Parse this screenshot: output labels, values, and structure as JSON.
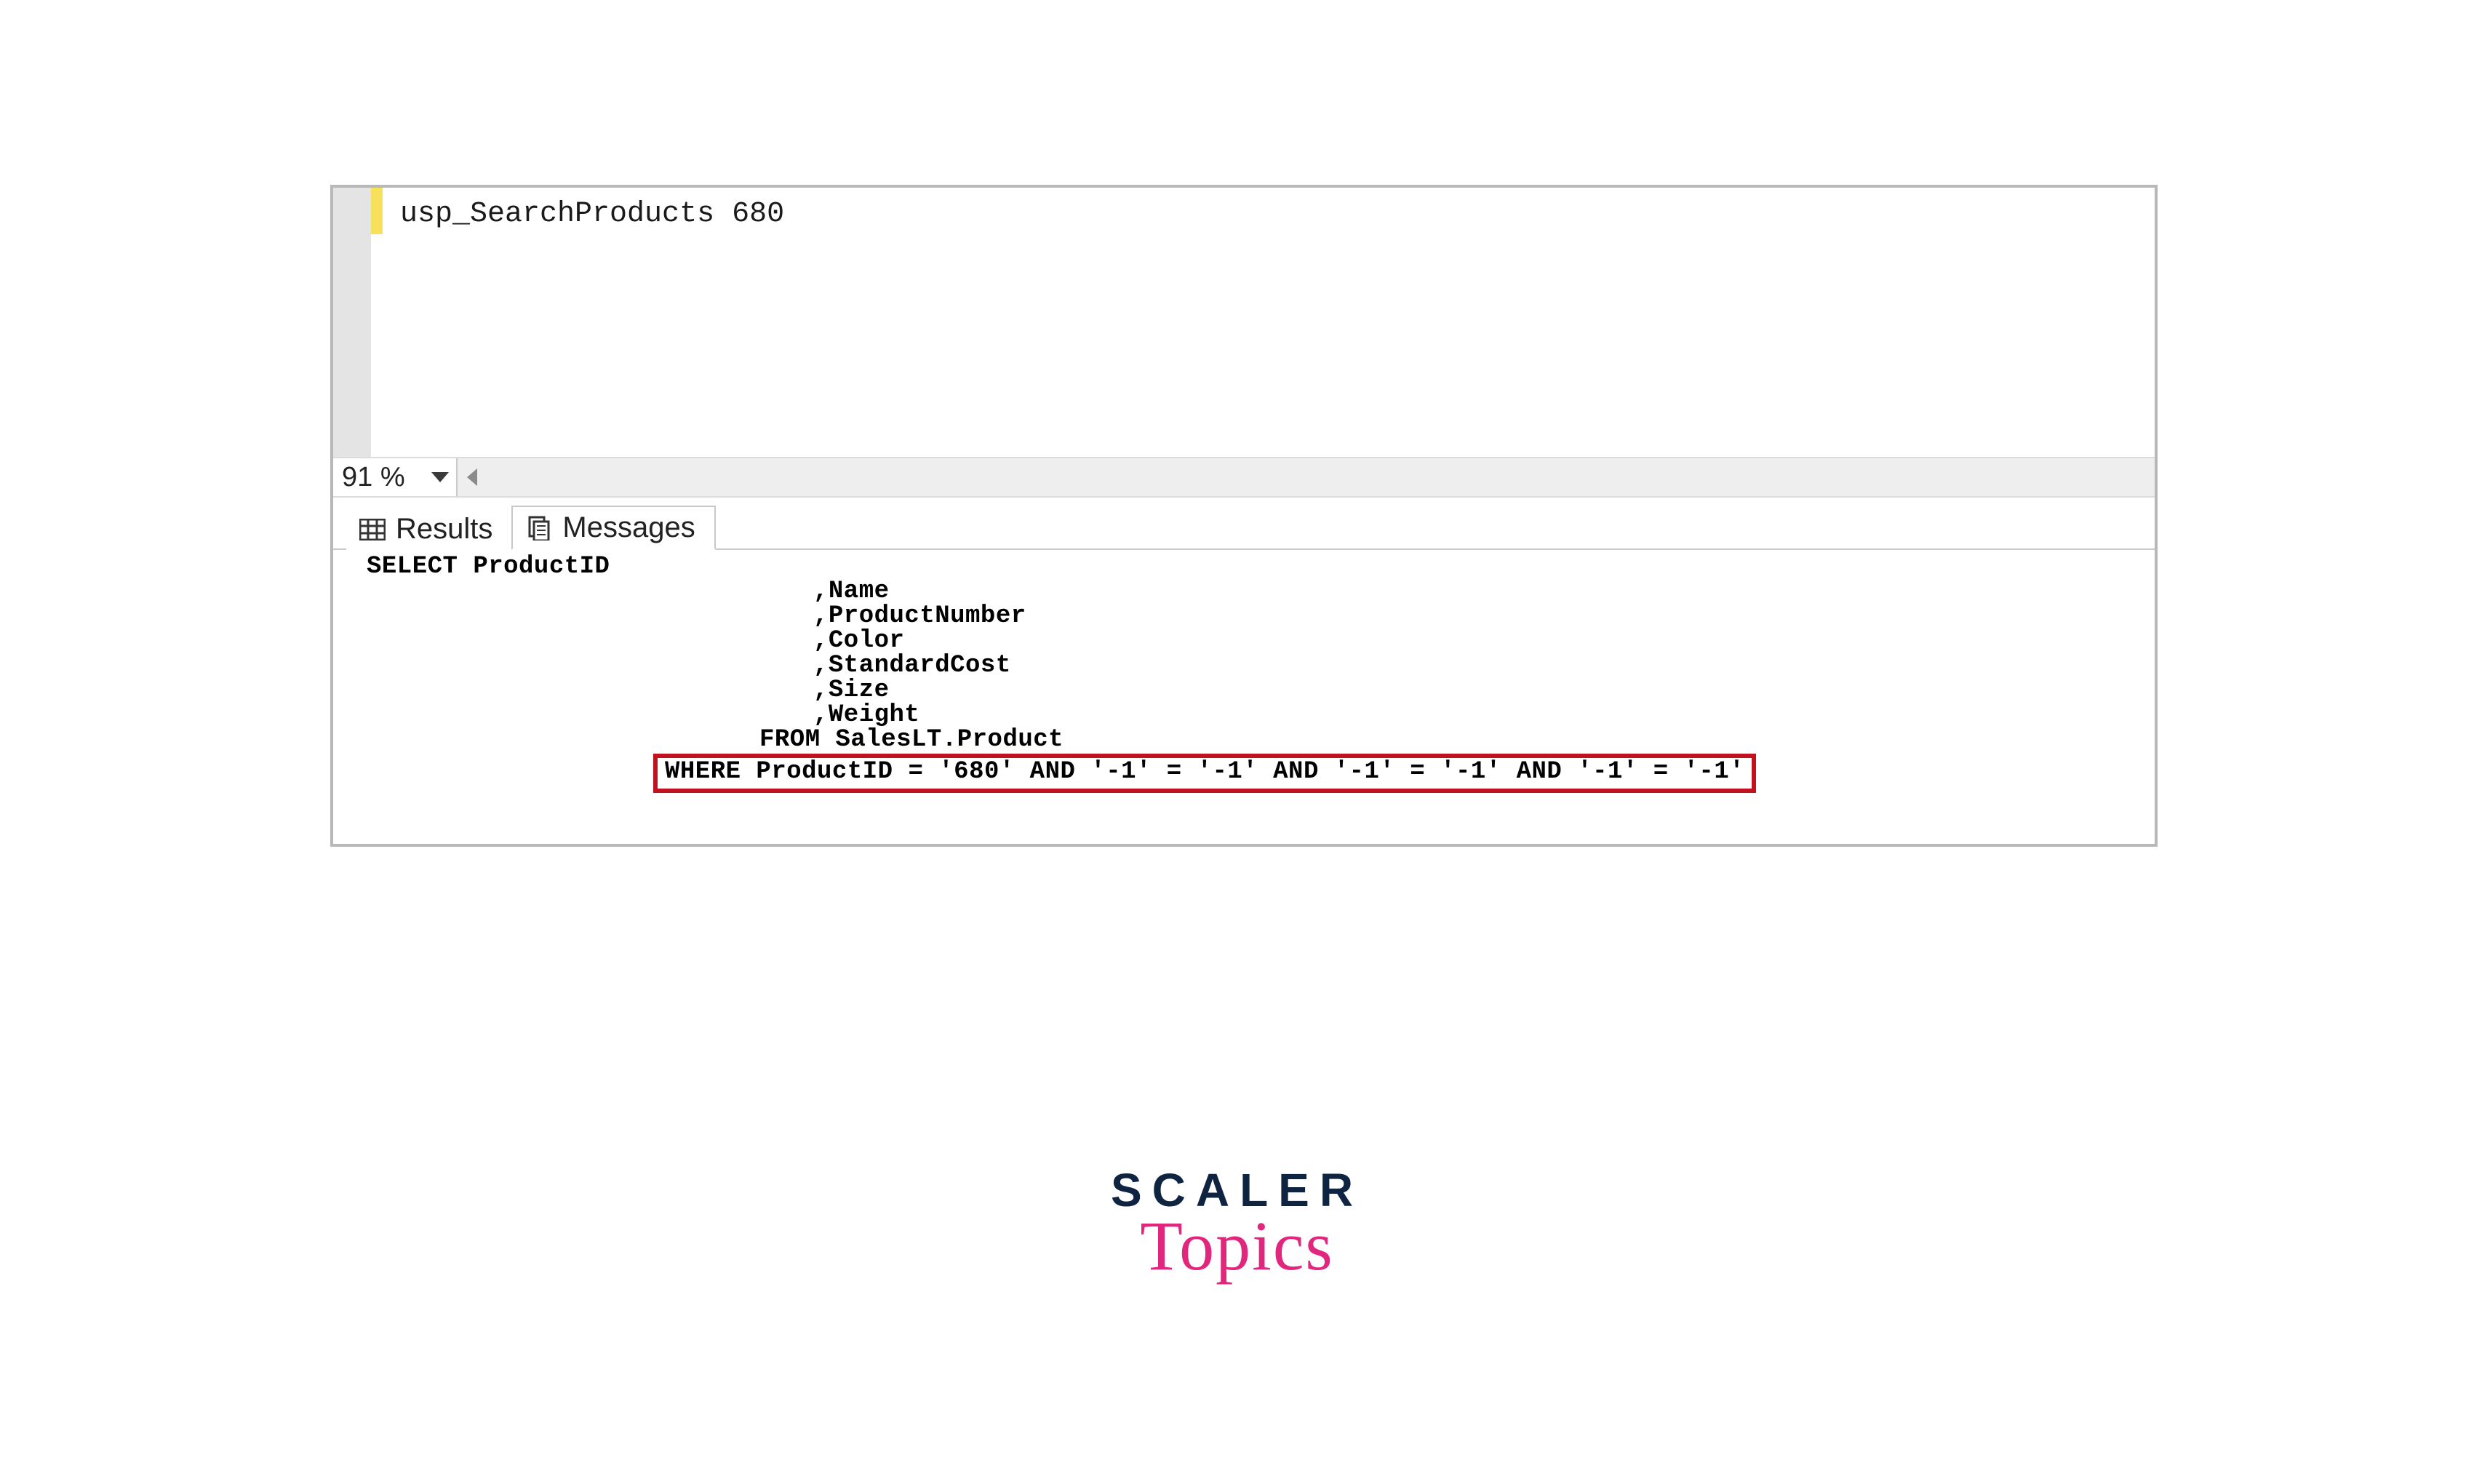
{
  "editor": {
    "sql_line": "usp_SearchProducts 680",
    "zoom_label": "91 %"
  },
  "tabs": {
    "results_label": "Results",
    "messages_label": "Messages"
  },
  "messages": {
    "select_line": "SELECT ProductID",
    "cols": [
      ",Name",
      ",ProductNumber",
      ",Color",
      ",StandardCost",
      ",Size",
      ",Weight"
    ],
    "from_line": "FROM SalesLT.Product",
    "where_line": "WHERE ProductID = '680' AND '-1' = '-1' AND '-1' = '-1' AND '-1' = '-1'"
  },
  "branding": {
    "main": "SCALER",
    "sub": "Topics"
  },
  "colors": {
    "highlight_border": "#c1121f",
    "brand_dark": "#0f2440",
    "brand_pink": "#e0267d"
  }
}
